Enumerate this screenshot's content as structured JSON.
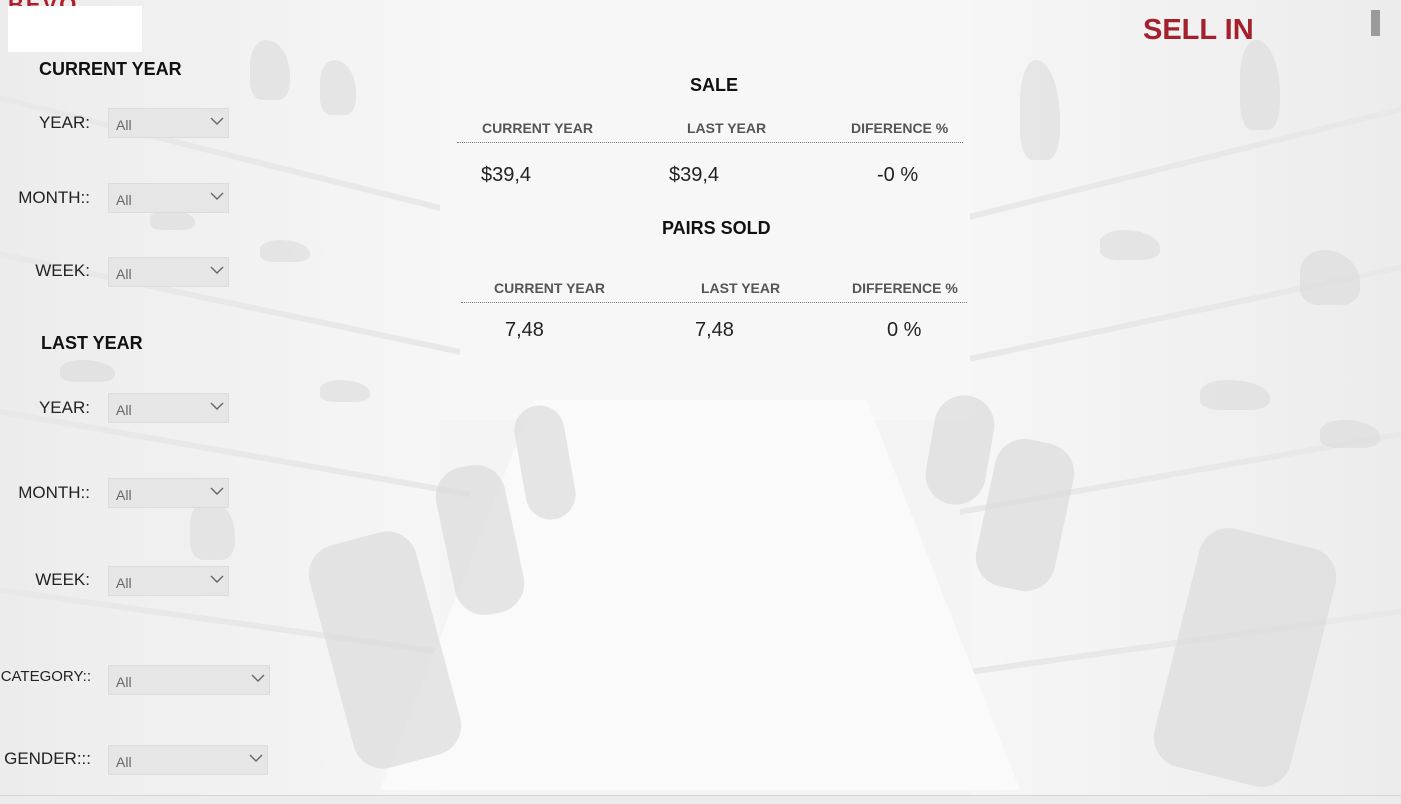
{
  "header": {
    "logo_text": "BEVO",
    "page_title": "SELL IN"
  },
  "filters": {
    "current_year": {
      "title": "CURRENT YEAR",
      "year": {
        "label": "YEAR:",
        "value": "All"
      },
      "month": {
        "label": "MONTH::",
        "value": "All"
      },
      "week": {
        "label": "WEEK:",
        "value": "All"
      }
    },
    "last_year": {
      "title": "LAST YEAR",
      "year": {
        "label": "YEAR:",
        "value": "All"
      },
      "month": {
        "label": "MONTH::",
        "value": "All"
      },
      "week": {
        "label": "WEEK:",
        "value": "All"
      }
    },
    "category": {
      "label": "CATEGORY::",
      "value": "All"
    },
    "gender": {
      "label": "GENDER:::",
      "value": "All"
    }
  },
  "sale": {
    "title": "SALE",
    "columns": [
      "CURRENT YEAR",
      "LAST YEAR",
      "DIFERENCE %"
    ],
    "values": [
      "$39,4",
      "$39,4",
      "-0 %"
    ]
  },
  "pairs_sold": {
    "title": "PAIRS SOLD",
    "columns": [
      "CURRENT YEAR",
      "LAST YEAR",
      "DIFFERENCE %"
    ],
    "values": [
      "7,48",
      "7,48",
      "0 %"
    ]
  },
  "colors": {
    "accent": "#a3202c",
    "dropdown_bg": "#e6e6e6"
  }
}
